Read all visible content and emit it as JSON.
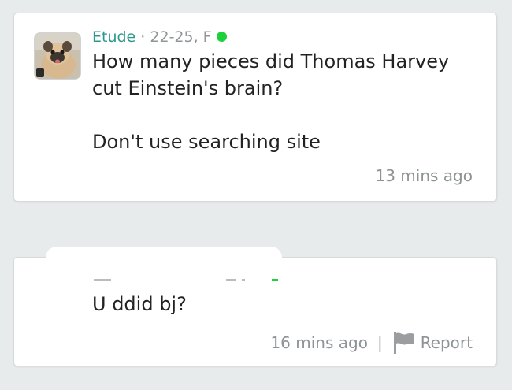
{
  "posts": [
    {
      "username": "Etude",
      "separator": "·",
      "demographics": "22-25, F",
      "message": "How many pieces did Thomas Harvey cut Einstein's brain?\n\nDon't use searching site",
      "timestamp": "13 mins ago",
      "online_color": "#1cd13b"
    },
    {
      "message": "U ddid bj?",
      "timestamp": "16 mins ago",
      "divider": "|",
      "report_label": "Report",
      "report_icon": "flag-icon"
    }
  ],
  "colors": {
    "background": "#e8ebec",
    "card": "#ffffff",
    "username": "#2b9a8c",
    "meta_text": "#909598",
    "body_text": "#222222"
  }
}
